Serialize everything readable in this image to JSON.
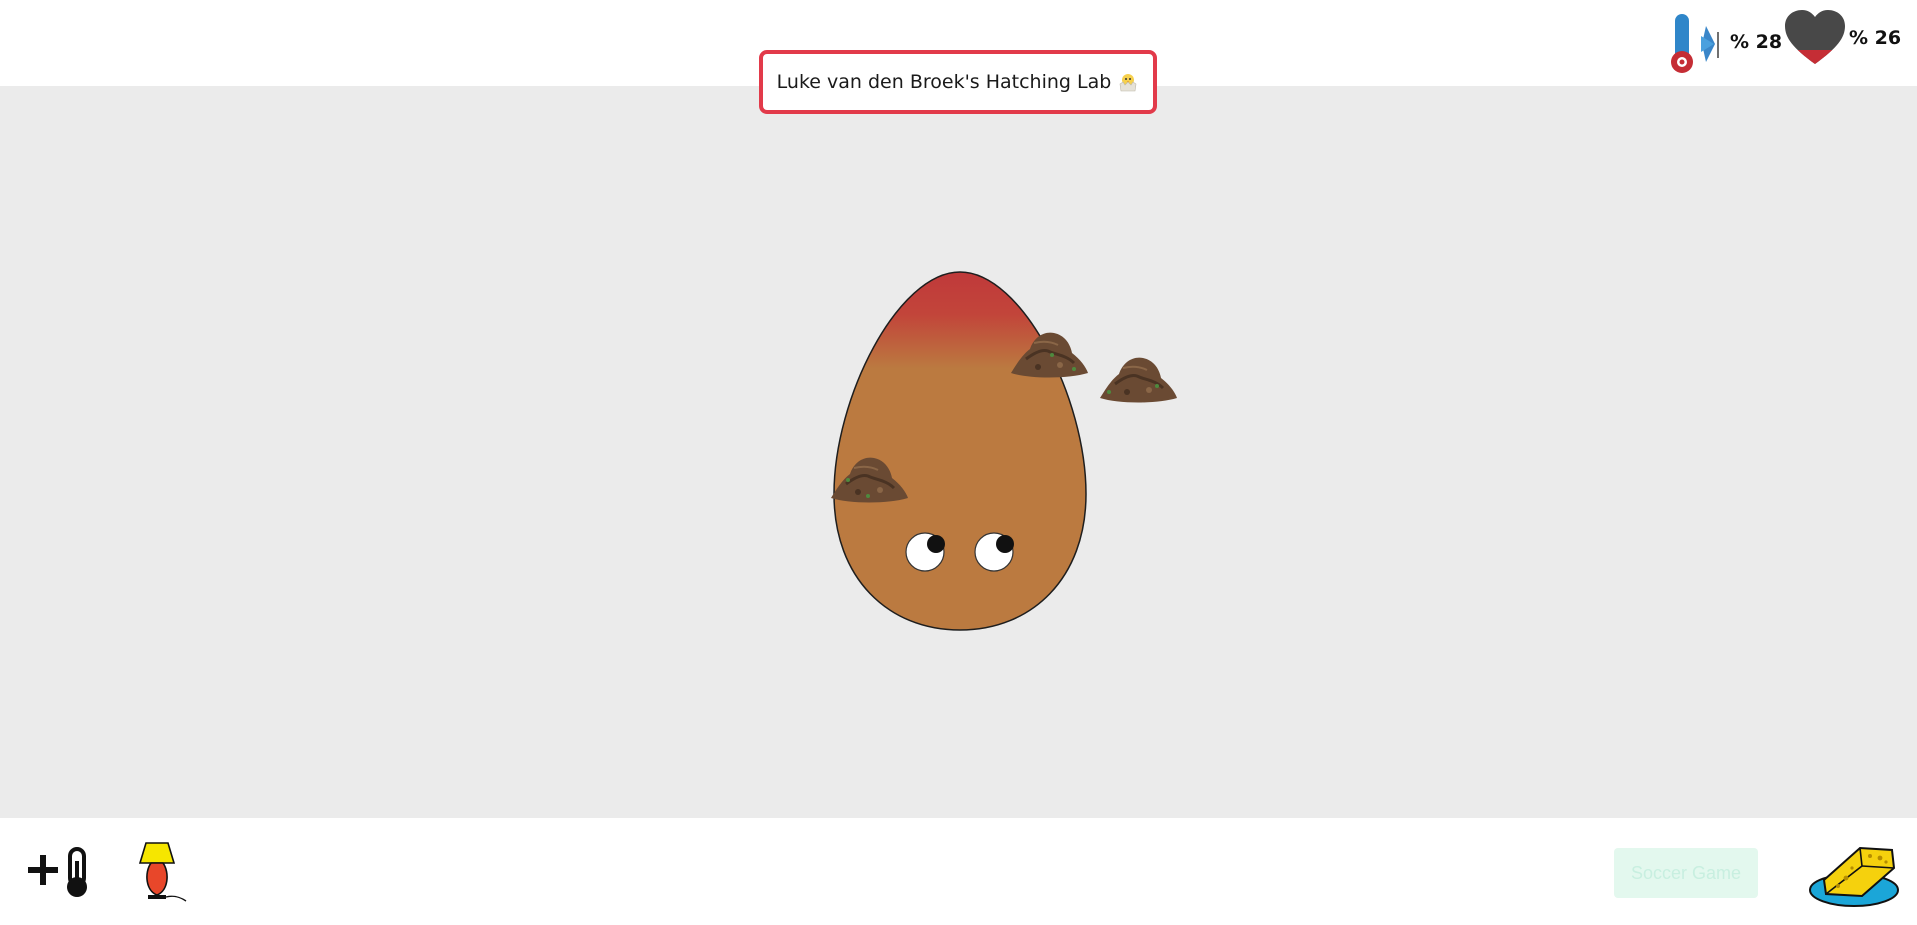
{
  "header": {
    "title": "Luke van den Broek's Hatching Lab",
    "title_emoji_icon": "hatching-chick-icon"
  },
  "stats": {
    "temperature": {
      "icon": "thermometer-fan-icon",
      "label": "% 28",
      "value_percent": 28
    },
    "love": {
      "icon": "heart-icon",
      "label": "% 26",
      "value_percent": 26
    }
  },
  "toolbar": {
    "heater_icon": "add-heat-thermometer-icon",
    "lamp_icon": "lamp-icon",
    "soccer_label": "Soccer Game",
    "sponge_icon": "sponge-icon"
  },
  "colors": {
    "accent_border": "#e23a4a",
    "egg_top": "#c0393a",
    "egg_body": "#bb7a40",
    "playfield": "#ebebeb",
    "heart": "#484848",
    "soccer_button_bg": "#e3f8ee"
  },
  "scene": {
    "creature": "egg",
    "dirt_piles": 3
  }
}
